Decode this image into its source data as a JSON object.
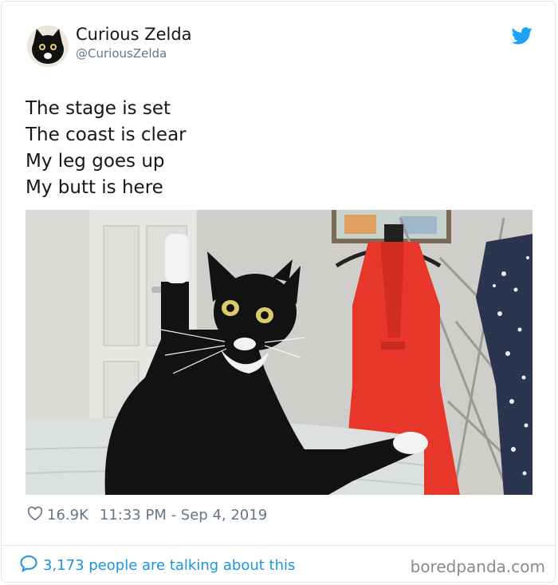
{
  "tweet": {
    "author": {
      "display_name": "Curious Zelda",
      "handle": "@CuriousZelda"
    },
    "text_lines": [
      "The stage is set",
      "The coast is clear",
      "My leg goes up",
      "My butt is here"
    ],
    "media": {
      "icon": "photo-of-tuxedo-cat-with-raised-leg"
    },
    "likes": "16.9K",
    "timestamp": "11:33 PM - Sep 4, 2019",
    "talking": "3,173 people are talking about this"
  },
  "watermark": "boredpanda.com",
  "colors": {
    "twitter_blue": "#1da1f2",
    "link_blue": "#1b95e0",
    "meta_gray": "#657786",
    "dress_red": "#e8372a"
  },
  "icons": {
    "platform": "twitter-bird-icon",
    "like": "heart-icon",
    "reply": "speech-bubble-icon"
  }
}
